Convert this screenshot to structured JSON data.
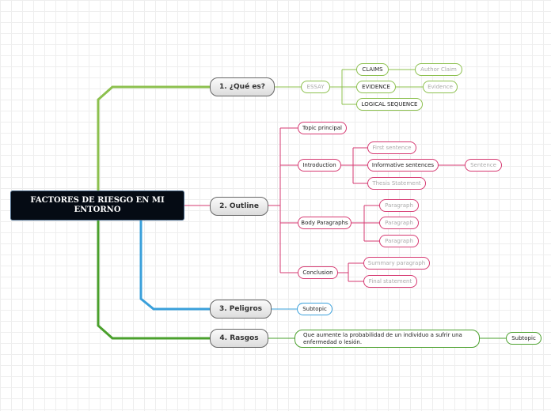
{
  "root": {
    "label": "FACTORES DE RIESGO EN MI ENTORNO"
  },
  "branches": [
    {
      "label": "1. ¿Qué es?"
    },
    {
      "label": "2. Outline"
    },
    {
      "label": "3. Peligros"
    },
    {
      "label": "4. Rasgos"
    }
  ],
  "que_es": {
    "essay": "ESSAY",
    "claims": "CLAIMS",
    "author_claim": "Author Claim",
    "evidence": "EVIDENCE",
    "evidence_sub": "Evidence",
    "logical_sequence": "LOGICAL SEQUENCE"
  },
  "outline": {
    "topic_principal": "Topic principal",
    "introduction": "Introduction",
    "first_sentence": "First sentence",
    "informative_sentences": "Informative sentences",
    "sentence": "Sentence",
    "thesis_statement": "Thesis Statement",
    "body_paragraphs": "Body Paragraphs",
    "paragraphs": [
      "Paragraph",
      "Paragraph",
      "Paragraph"
    ],
    "conclusion": "Conclusion",
    "summary_paragraph": "Summary paragraph",
    "final_statement": "Final statement"
  },
  "peligros": {
    "subtopic": "Subtopic"
  },
  "rasgos": {
    "definition": "Que aumente la probabilidad de un individuo a sufrir una enfermedad o lesión.",
    "subtopic": "Subtopic"
  },
  "colors": {
    "green": "#8cc04e",
    "dark_green": "#4aa02c",
    "pink": "#d63a72",
    "blue": "#3aa0db",
    "root_bg": "#050b14"
  }
}
